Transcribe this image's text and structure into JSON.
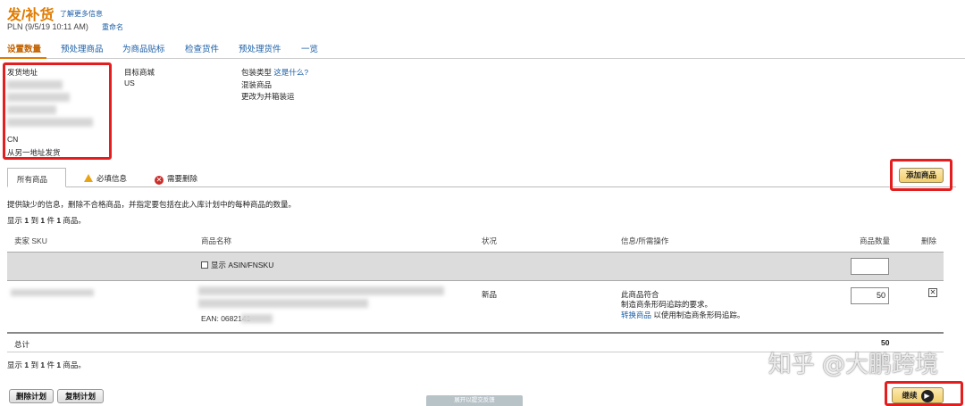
{
  "header": {
    "title": "发/补货",
    "learn_more": "了解更多信息",
    "subtitle": "PLN (9/5/19 10:11 AM)",
    "rename": "重命名"
  },
  "tabs": [
    {
      "label": "设置数量",
      "active": true
    },
    {
      "label": "预处理商品",
      "active": false
    },
    {
      "label": "为商品贴标",
      "active": false
    },
    {
      "label": "检查货件",
      "active": false
    },
    {
      "label": "预处理货件",
      "active": false
    },
    {
      "label": "一览",
      "active": false
    }
  ],
  "ship_from": {
    "label": "发货地址",
    "country": "CN",
    "other_address_link": "从另一地址发货"
  },
  "destination": {
    "label": "目标商城",
    "value": "US"
  },
  "packing": {
    "label": "包装类型",
    "what_is_this": "这是什么?",
    "value": "混装商品",
    "change_link": "更改为并箱装运"
  },
  "subtabs": {
    "all": "所有商品",
    "required_info": "必填信息",
    "needs_removal": "需要删除"
  },
  "add_product_button": "添加商品",
  "instructions": "提供缺少的信息，删除不合格商品，并指定要包括在此入库计划中的每种商品的数量。",
  "showing_top": {
    "prefix": "显示 ",
    "from": "1",
    "mid1": " 到 ",
    "to": "1",
    "mid2": " 件 ",
    "total": "1",
    "suffix": " 商品。"
  },
  "table": {
    "headers": {
      "sku": "卖家 SKU",
      "name": "商品名称",
      "condition": "状况",
      "info": "信息/所需操作",
      "quantity": "商品数量",
      "delete": "删除"
    },
    "show_asin_label": "显示 ASIN/FNSKU",
    "row": {
      "ean": "EAN: 0682141",
      "condition": "新品",
      "info_line1": "此商品符合",
      "info_link1": "制造商条形码追踪的要求。",
      "info_link2": "转换商品",
      "info_line2": " 以使用制造商条形码追踪。",
      "quantity": "50",
      "delete_symbol": "✕"
    },
    "total_label": "总计",
    "total_value": "50"
  },
  "showing_bottom": {
    "prefix": "显示 ",
    "from": "1",
    "mid1": " 到 ",
    "to": "1",
    "mid2": " 件 ",
    "total": "1",
    "suffix": " 商品。"
  },
  "footer": {
    "delete_plan": "删除计划",
    "copy_plan": "复制计划",
    "feedback": "展开以提交反馈",
    "continue": "继续"
  },
  "watermark": "知乎 @大鹏跨境",
  "colors": {
    "accent_orange": "#e07b00",
    "link_blue": "#1b5ea6",
    "highlight_red": "#e41e1e",
    "button_gold": "#f2ce6a"
  }
}
